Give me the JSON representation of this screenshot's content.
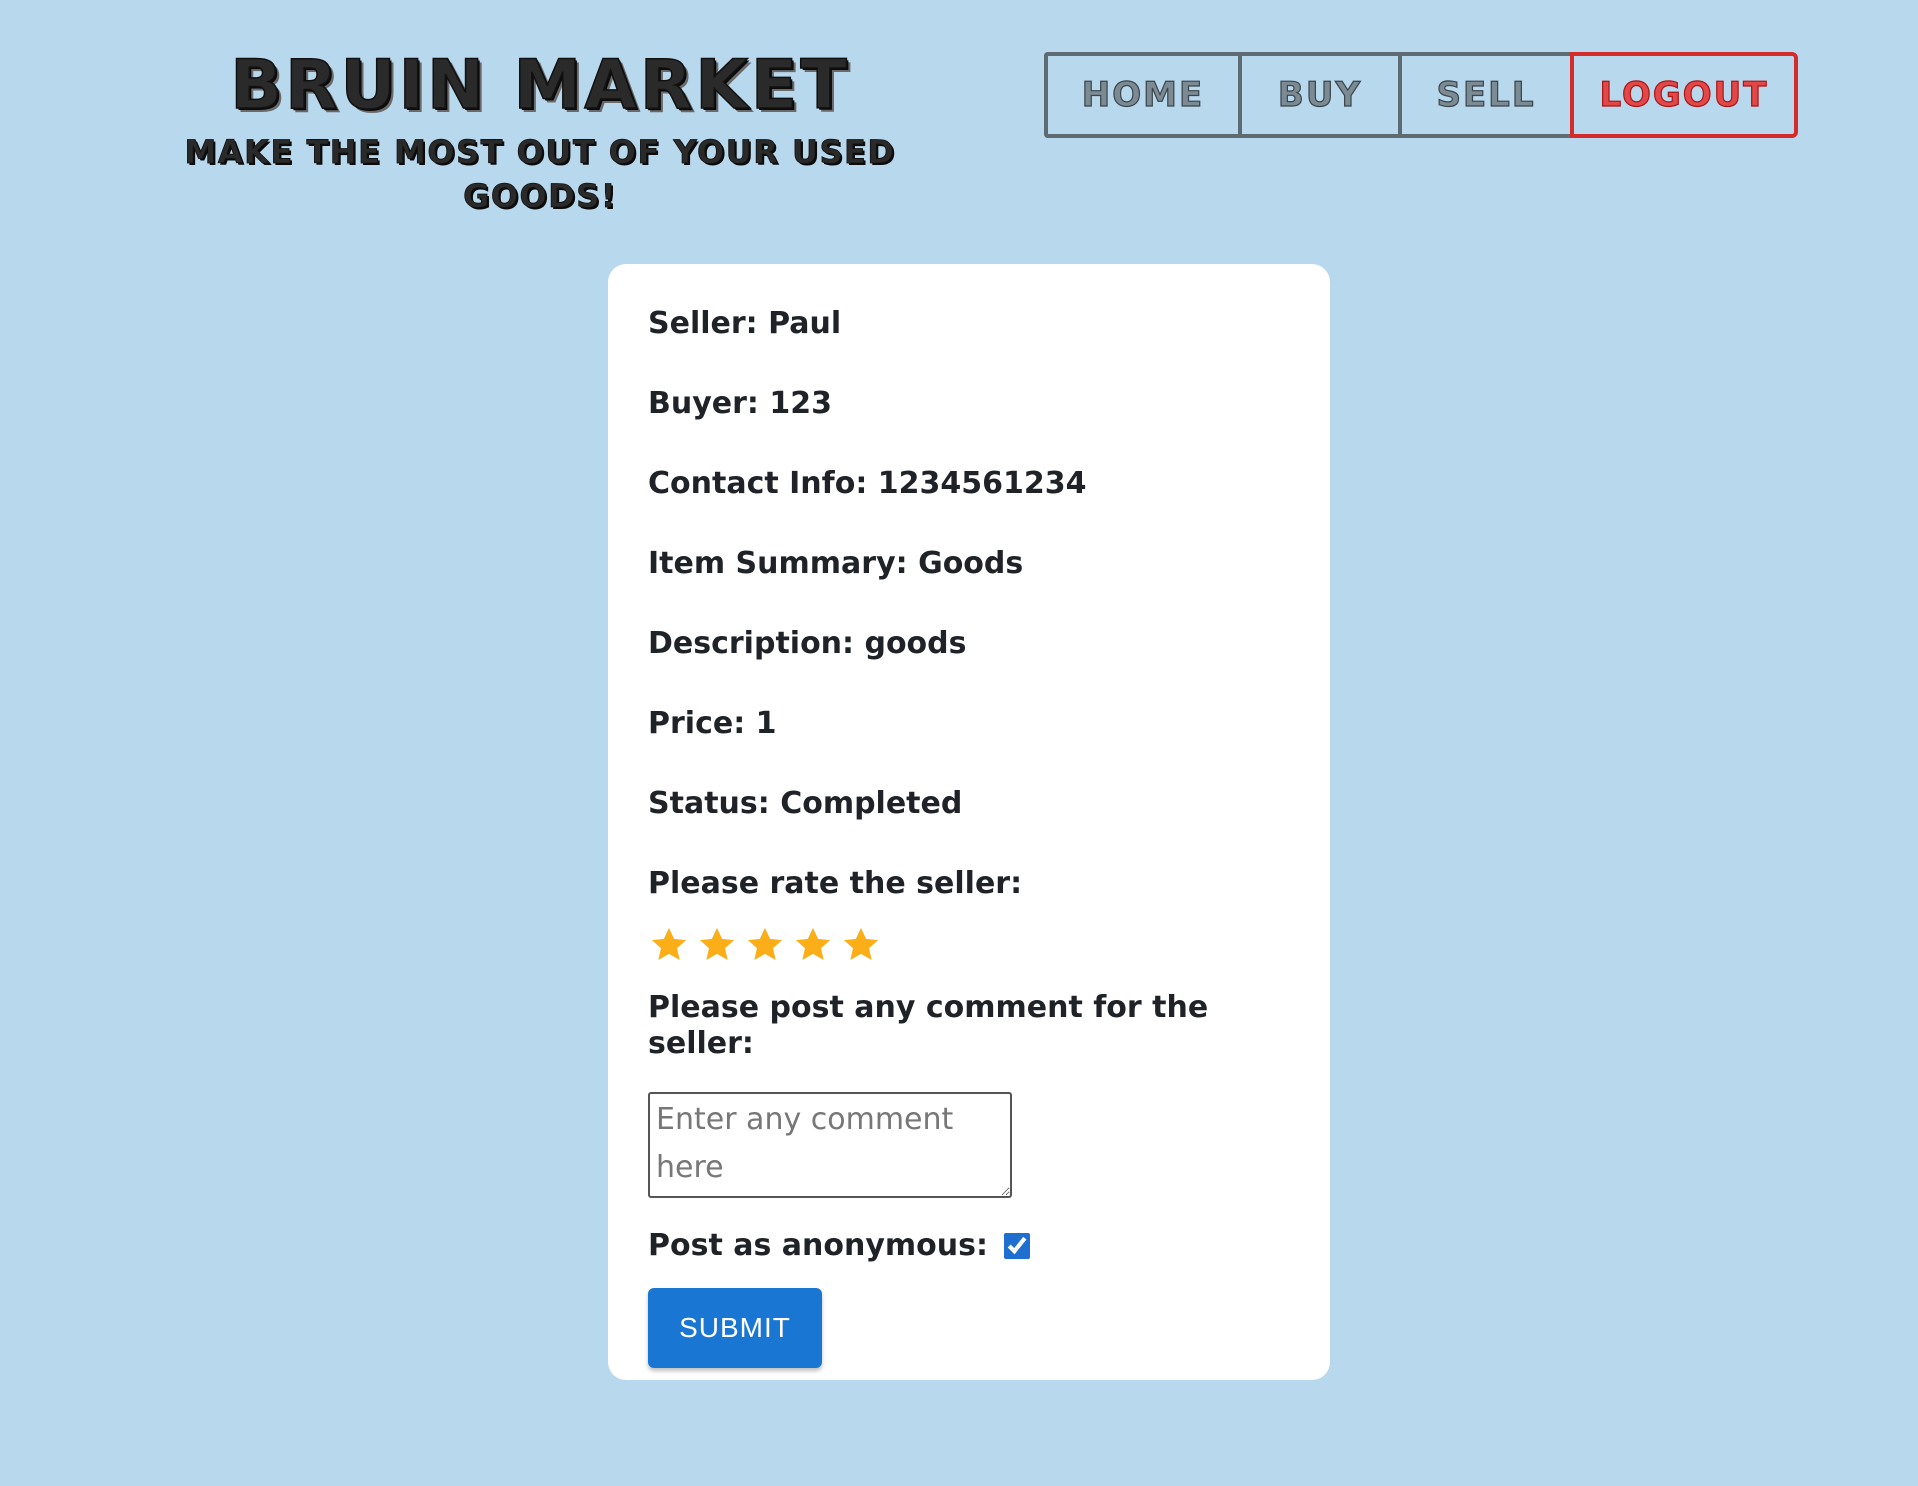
{
  "brand": {
    "title": "BRUIN MARKET",
    "subtitle": "MAKE THE MOST OUT OF YOUR USED GOODS!"
  },
  "nav": {
    "home": "HOME",
    "buy": "BUY",
    "sell": "SELL",
    "logout": "LOGOUT"
  },
  "details": {
    "seller": "Seller: Paul",
    "buyer": "Buyer: 123",
    "contact": "Contact Info: 1234561234",
    "summary": "Item Summary: Goods",
    "description": "Description: goods",
    "price": "Price: 1",
    "status": "Status: Completed"
  },
  "rating": {
    "label": "Please rate the seller:",
    "value": 5,
    "max": 5,
    "star_icon": "star-icon",
    "color": "#fbae17"
  },
  "comment": {
    "label": "Please post any comment for the seller:",
    "placeholder": "Enter any comment here",
    "value": ""
  },
  "anonymous": {
    "label": "Post as anonymous:",
    "checked": true
  },
  "submit": {
    "label": "SUBMIT"
  },
  "colors": {
    "background": "#b8d8ee",
    "card": "#ffffff",
    "primary": "#1976d2",
    "logout": "#d62b2b"
  }
}
